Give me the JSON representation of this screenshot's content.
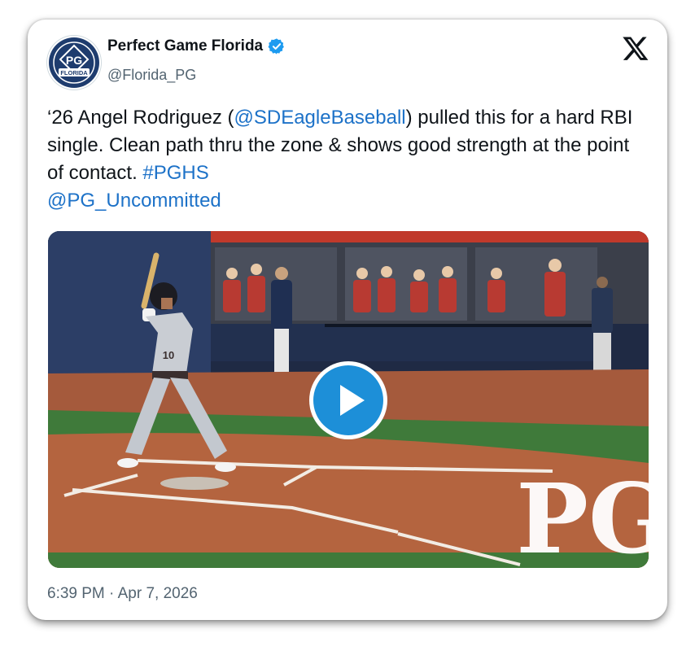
{
  "author": {
    "name": "Perfect Game Florida",
    "handle": "@Florida_PG",
    "avatar_badge_text": "FLORIDA",
    "avatar_monogram": "PG",
    "verified_icon": "verified-badge-icon"
  },
  "platform_icon": "x-logo-icon",
  "tweet": {
    "text_part1": "‘26 Angel Rodriguez (",
    "mention1": "@SDEagleBaseball",
    "text_part2": ") pulled this for a hard RBI single. Clean path thru the zone & shows good strength at the point of contact. ",
    "hashtag": "#PGHS",
    "mention2": "@PG_Uncommitted"
  },
  "media": {
    "type": "video",
    "play_icon": "play-icon",
    "watermark": "PG",
    "jersey_number": "10"
  },
  "timestamp": "6:39 PM · Apr 7, 2026",
  "colors": {
    "link": "#1d72c8",
    "play_button": "#1d8fd8",
    "verified": "#1d9bf0",
    "avatar_navy": "#1e3c6e"
  }
}
